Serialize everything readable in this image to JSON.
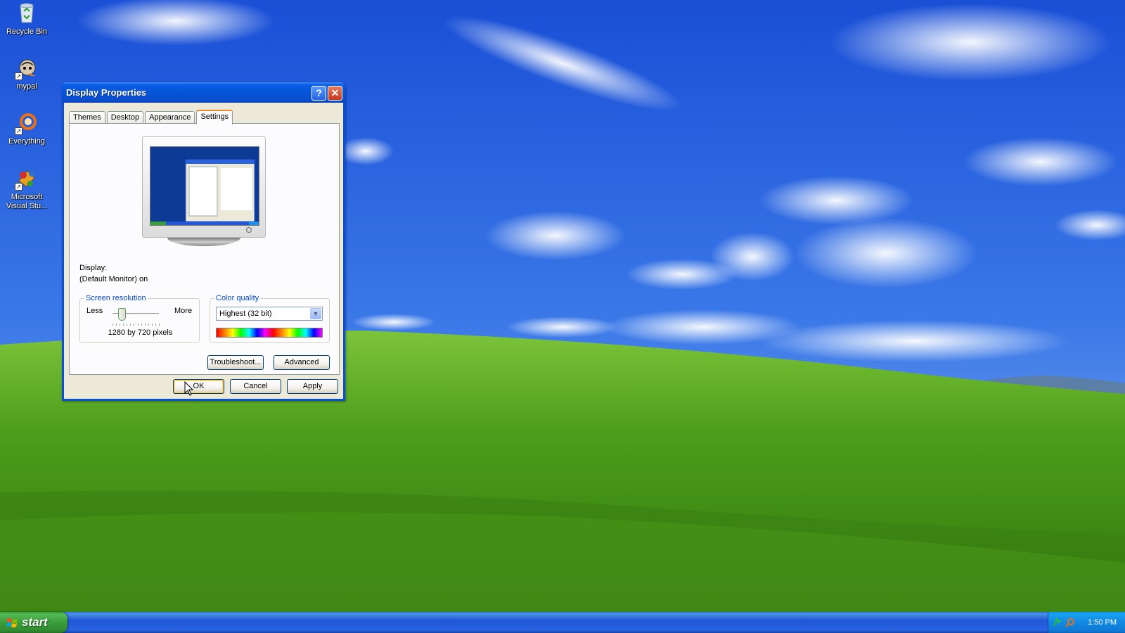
{
  "desktop": {
    "icons": [
      {
        "label": "Recycle Bin",
        "icon": "recycle-bin-icon"
      },
      {
        "label": "mypal",
        "icon": "mypal-icon"
      },
      {
        "label": "Everything",
        "icon": "everything-search-icon"
      },
      {
        "label": "Microsoft Visual Stu...",
        "icon": "visual-studio-icon"
      }
    ]
  },
  "window": {
    "title": "Display Properties",
    "help_glyph": "?",
    "close_glyph": "✕",
    "tabs": [
      {
        "label": "Themes",
        "active": false
      },
      {
        "label": "Desktop",
        "active": false
      },
      {
        "label": "Appearance",
        "active": false
      },
      {
        "label": "Settings",
        "active": true
      }
    ],
    "display_label": "Display:",
    "display_value": "(Default Monitor) on",
    "screen_resolution": {
      "legend": "Screen resolution",
      "less_label": "Less",
      "more_label": "More",
      "value_text": "1280 by 720 pixels",
      "slider_position": 0.2
    },
    "color_quality": {
      "legend": "Color quality",
      "selected": "Highest (32 bit)"
    },
    "buttons": {
      "troubleshoot": "Troubleshoot...",
      "advanced": "Advanced",
      "ok": "OK",
      "cancel": "Cancel",
      "apply": "Apply"
    }
  },
  "taskbar": {
    "start_label": "start",
    "clock": "1:50 PM",
    "tray_icons": [
      "network-icon",
      "search-icon"
    ]
  },
  "colors": {
    "title_bar": "#0554d8",
    "dialog_face": "#ece9d8",
    "legend_text": "#0046d5",
    "start_green": "#3a9c3a",
    "taskbar_blue": "#2157d7"
  }
}
